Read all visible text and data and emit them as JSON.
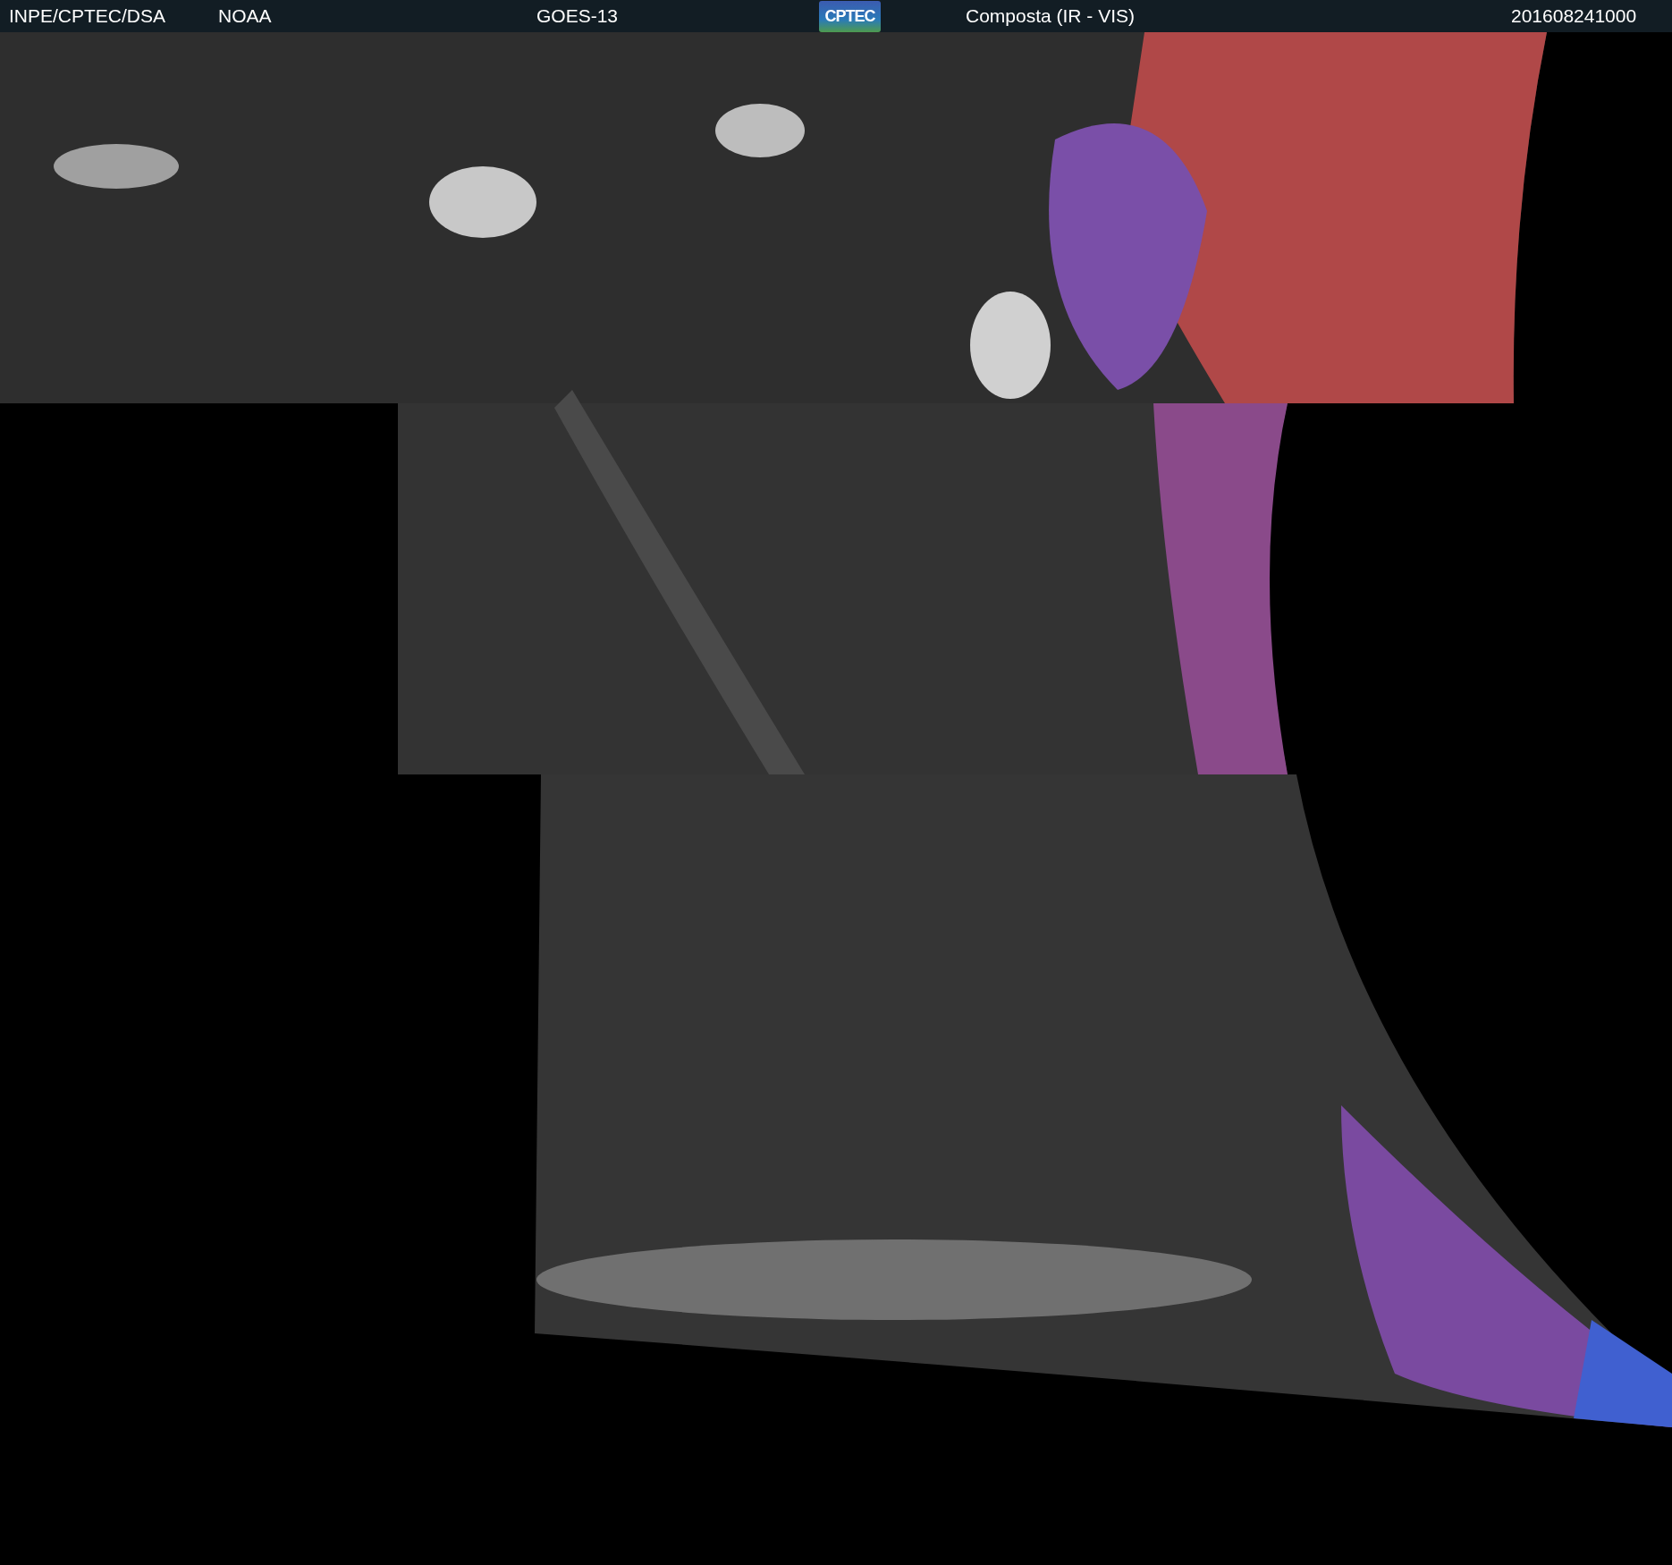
{
  "header": {
    "institution": "INPE/CPTEC/DSA",
    "agency": "NOAA",
    "satellite": "GOES-13",
    "logo": "CPTEC",
    "product": "Composta (IR - VIS)",
    "timestamp": "201608241000"
  }
}
